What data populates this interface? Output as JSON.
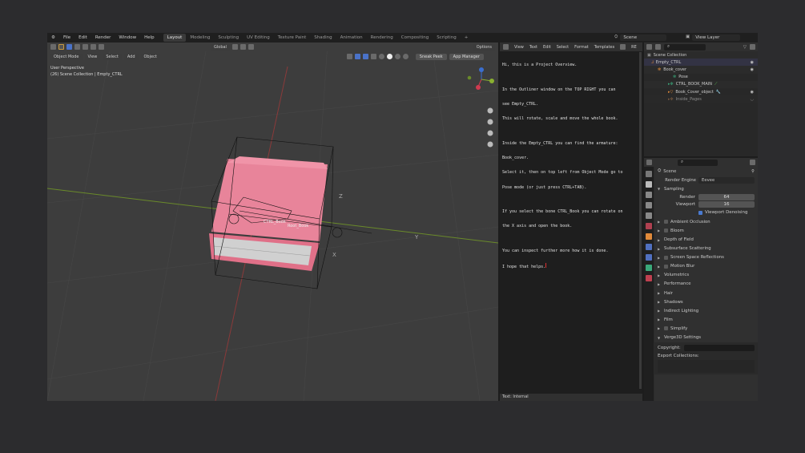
{
  "menu": [
    "File",
    "Edit",
    "Render",
    "Window",
    "Help"
  ],
  "workspaces": [
    "Layout",
    "Modeling",
    "Sculpting",
    "UV Editing",
    "Texture Paint",
    "Shading",
    "Animation",
    "Rendering",
    "Compositing",
    "Scripting",
    "+"
  ],
  "scene": "Scene",
  "view_layer": "View Layer",
  "viewport": {
    "orientation": "Global",
    "mode": "Object Mode",
    "menus": [
      "View",
      "Select",
      "Add",
      "Object"
    ],
    "options": "Options",
    "sneak_peek": "Sneak Peek",
    "app_manager": "App Manager",
    "perspective": "User Perspective",
    "collection_info": "(26) Scene Collection | Empty_CTRL",
    "bone_ctrl": "CTRL_Book",
    "bone_root": "Root_Book",
    "axis_z": "Z",
    "axis_x": "X",
    "axis_y": "Y"
  },
  "text_editor": {
    "menus": [
      "View",
      "Text",
      "Edit",
      "Select",
      "Format",
      "Templates"
    ],
    "lines": [
      "Hi, this is a Project Overview.",
      "",
      "In the Outliner window on the TOP RIGHT you can",
      "see Empty_CTRL.",
      "This will rotate, scale and move the whole book.",
      "",
      "Inside the Empty_CTRL you can find the armature:",
      "Book_cover.",
      "Select it, then on top left from Object Mode go to",
      "Pose mode (or just press CTRL+TAB).",
      "",
      "If you select the bone CTRL_Book you can rotate on",
      "the X axis and open the book.",
      "",
      "You can inspect further more how it is done.",
      "I hope that helps."
    ],
    "footer": "Text: Internal",
    "datablock": "RE"
  },
  "outliner": {
    "items": [
      {
        "label": "Scene Collection",
        "indent": 0,
        "color": "#9a9a9a"
      },
      {
        "label": "Empty_CTRL",
        "indent": 1,
        "color": "#e08a3a"
      },
      {
        "label": "Book_cover",
        "indent": 2,
        "color": "#e08a3a"
      },
      {
        "label": "Pose",
        "indent": 3,
        "color": "#3aa87a"
      },
      {
        "label": "CTRL_BOOK_MAIN",
        "indent": 3,
        "color": "#3aa87a"
      },
      {
        "label": "Book_Cover_object",
        "indent": 3,
        "color": "#e08a3a"
      },
      {
        "label": "Inside_Pages",
        "indent": 3,
        "color": "#b07a50"
      }
    ]
  },
  "properties": {
    "scene": "Scene",
    "render_engine_label": "Render Engine",
    "render_engine": "Eevee",
    "sampling": "Sampling",
    "render_label": "Render",
    "render_value": "64",
    "viewport_label": "Viewport",
    "viewport_value": "16",
    "viewport_denoising": "Viewport Denoising",
    "panels": [
      {
        "label": "Ambient Occlusion",
        "check": true
      },
      {
        "label": "Bloom",
        "check": true
      },
      {
        "label": "Depth of Field",
        "check": false
      },
      {
        "label": "Subsurface Scattering",
        "check": false
      },
      {
        "label": "Screen Space Reflections",
        "check": true
      },
      {
        "label": "Motion Blur",
        "check": true
      },
      {
        "label": "Volumetrics",
        "check": false
      },
      {
        "label": "Performance",
        "check": false
      },
      {
        "label": "Hair",
        "check": false
      },
      {
        "label": "Shadows",
        "check": false
      },
      {
        "label": "Indirect Lighting",
        "check": false
      },
      {
        "label": "Film",
        "check": false
      },
      {
        "label": "Simplify",
        "check": true
      },
      {
        "label": "Verge3D Settings",
        "check": false
      }
    ],
    "copyright_label": "Copyright:",
    "export_collections_label": "Export Collections:"
  }
}
